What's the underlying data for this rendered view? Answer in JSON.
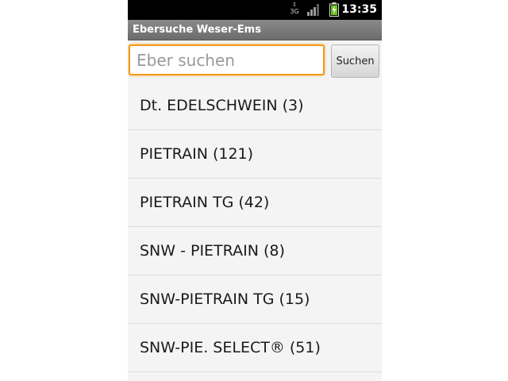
{
  "status_bar": {
    "network_label": "3G",
    "time": "13:35"
  },
  "app": {
    "title": "Ebersuche Weser-Ems"
  },
  "search": {
    "placeholder": "Eber suchen",
    "value": "",
    "button_label": "Suchen"
  },
  "list": {
    "items": [
      "Dt. EDELSCHWEIN (3)",
      "PIETRAIN (121)",
      "PIETRAIN TG (42)",
      "SNW - PIETRAIN (8)",
      "SNW-PIETRAIN TG (15)",
      "SNW-PIE. SELECT® (51)"
    ]
  },
  "icons": {
    "network": "network-updown-icon",
    "signal": "signal-strength-icon",
    "battery": "battery-charging-icon"
  },
  "colors": {
    "focus_accent": "#f29a1c",
    "title_bar": "#7a7a7a",
    "battery_fill": "#6ec01e"
  }
}
